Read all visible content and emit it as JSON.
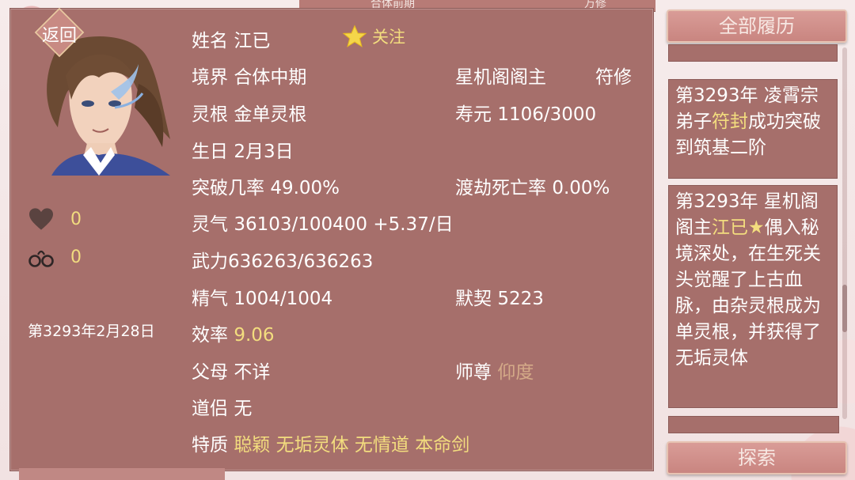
{
  "header": {
    "top_left_text": "合体前期",
    "top_right_text": "万修"
  },
  "back_button": {
    "label": "返回"
  },
  "character": {
    "name_label": "姓名",
    "name": "江已",
    "follow_label": "关注",
    "realm_label": "境界",
    "realm": "合体中期",
    "position_title": "星机阁阁主",
    "position_role": "符修",
    "root_label": "灵根",
    "root": "金单灵根",
    "lifespan_label": "寿元",
    "lifespan": "1106/3000",
    "birthday_label": "生日",
    "birthday": "2月3日",
    "breakthrough_label": "突破几率",
    "breakthrough": "49.00%",
    "tribulation_label": "渡劫死亡率",
    "tribulation": "0.00%",
    "qi_label": "灵气",
    "qi": "36103/100400 +5.37/日",
    "force_label": "武力",
    "force": "636263/636263",
    "essence_label": "精气",
    "essence": "1004/1004",
    "tacit_label": "默契",
    "tacit": "5223",
    "efficiency_label": "效率",
    "efficiency": "9.06",
    "parents_label": "父母",
    "parents": "不详",
    "master_label": "师尊",
    "master": "仰度",
    "partner_label": "道侣",
    "partner": "无",
    "traits_label": "特质",
    "traits": "聪颖 无垢灵体 无情道 本命剑"
  },
  "stats": {
    "hearts": "0",
    "shackles": "0"
  },
  "date": "第3293年2月28日",
  "right_panel": {
    "all_history_button": "全部履历",
    "explore_button": "探索",
    "log1": {
      "p1": "第3293年 凌霄宗弟子",
      "hl": "符封",
      "p2": "成功突破到筑基二阶"
    },
    "log2": {
      "p1": "第3293年 星机阁阁主",
      "hl": "江已★",
      "p2": "偶入秘境深处，在生死关头觉醒了上古血脉，由杂灵根成为单灵根，并获得了无垢灵体"
    }
  },
  "colors": {
    "panel": "#a66f6b",
    "gold": "#f3dd7e",
    "dim": "#d4aa88"
  }
}
